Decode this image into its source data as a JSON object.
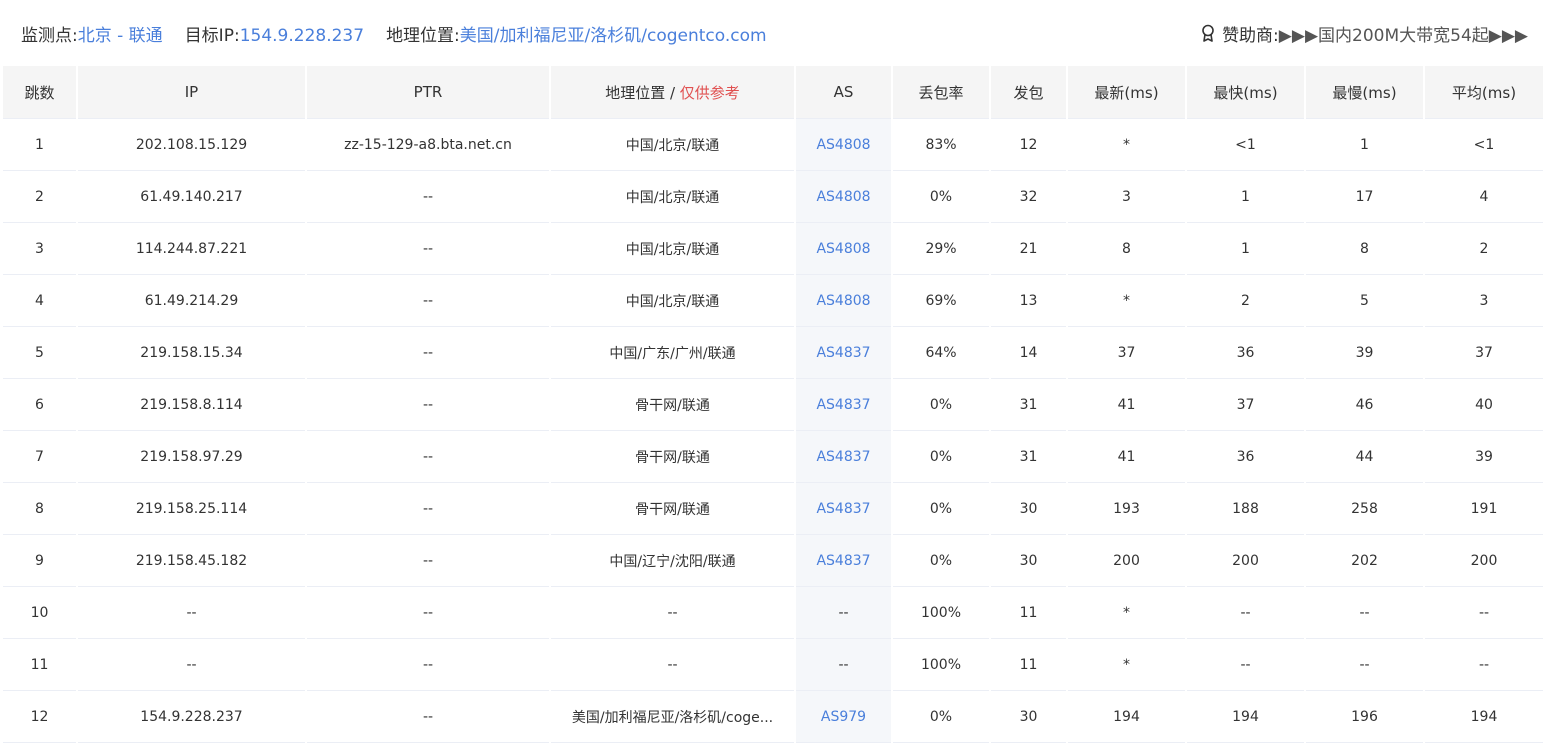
{
  "header": {
    "monitor_label": "监测点:",
    "monitor_value": "北京 - 联通",
    "target_label": "目标IP:",
    "target_value": "154.9.228.237",
    "geo_label": "地理位置:",
    "geo_value": "美国/加利福尼亚/洛杉矶/cogentco.com",
    "sponsor_icon": "award-icon",
    "sponsor_label": "赞助商:",
    "sponsor_text": "▶▶▶国内200M大带宽54起▶▶▶"
  },
  "columns": {
    "hop": "跳数",
    "ip": "IP",
    "ptr": "PTR",
    "geo": "地理位置",
    "geo_sep": " / ",
    "geo_note": "仅供参考",
    "as": "AS",
    "loss": "丢包率",
    "sent": "发包",
    "last": "最新(ms)",
    "best": "最快(ms)",
    "worst": "最慢(ms)",
    "avg": "平均(ms)"
  },
  "rows": [
    {
      "hop": "1",
      "ip": "202.108.15.129",
      "ptr": "zz-15-129-a8.bta.net.cn",
      "geo": "中国/北京/联通",
      "as": "AS4808",
      "loss": "83%",
      "sent": "12",
      "last": "*",
      "best": "<1",
      "worst": "1",
      "avg": "<1"
    },
    {
      "hop": "2",
      "ip": "61.49.140.217",
      "ptr": "--",
      "geo": "中国/北京/联通",
      "as": "AS4808",
      "loss": "0%",
      "sent": "32",
      "last": "3",
      "best": "1",
      "worst": "17",
      "avg": "4"
    },
    {
      "hop": "3",
      "ip": "114.244.87.221",
      "ptr": "--",
      "geo": "中国/北京/联通",
      "as": "AS4808",
      "loss": "29%",
      "sent": "21",
      "last": "8",
      "best": "1",
      "worst": "8",
      "avg": "2"
    },
    {
      "hop": "4",
      "ip": "61.49.214.29",
      "ptr": "--",
      "geo": "中国/北京/联通",
      "as": "AS4808",
      "loss": "69%",
      "sent": "13",
      "last": "*",
      "best": "2",
      "worst": "5",
      "avg": "3"
    },
    {
      "hop": "5",
      "ip": "219.158.15.34",
      "ptr": "--",
      "geo": "中国/广东/广州/联通",
      "as": "AS4837",
      "loss": "64%",
      "sent": "14",
      "last": "37",
      "best": "36",
      "worst": "39",
      "avg": "37"
    },
    {
      "hop": "6",
      "ip": "219.158.8.114",
      "ptr": "--",
      "geo": "骨干网/联通",
      "as": "AS4837",
      "loss": "0%",
      "sent": "31",
      "last": "41",
      "best": "37",
      "worst": "46",
      "avg": "40"
    },
    {
      "hop": "7",
      "ip": "219.158.97.29",
      "ptr": "--",
      "geo": "骨干网/联通",
      "as": "AS4837",
      "loss": "0%",
      "sent": "31",
      "last": "41",
      "best": "36",
      "worst": "44",
      "avg": "39"
    },
    {
      "hop": "8",
      "ip": "219.158.25.114",
      "ptr": "--",
      "geo": "骨干网/联通",
      "as": "AS4837",
      "loss": "0%",
      "sent": "30",
      "last": "193",
      "best": "188",
      "worst": "258",
      "avg": "191"
    },
    {
      "hop": "9",
      "ip": "219.158.45.182",
      "ptr": "--",
      "geo": "中国/辽宁/沈阳/联通",
      "as": "AS4837",
      "loss": "0%",
      "sent": "30",
      "last": "200",
      "best": "200",
      "worst": "202",
      "avg": "200"
    },
    {
      "hop": "10",
      "ip": "--",
      "ptr": "--",
      "geo": "--",
      "as": "--",
      "loss": "100%",
      "sent": "11",
      "last": "*",
      "best": "--",
      "worst": "--",
      "avg": "--"
    },
    {
      "hop": "11",
      "ip": "--",
      "ptr": "--",
      "geo": "--",
      "as": "--",
      "loss": "100%",
      "sent": "11",
      "last": "*",
      "best": "--",
      "worst": "--",
      "avg": "--"
    },
    {
      "hop": "12",
      "ip": "154.9.228.237",
      "ptr": "--",
      "geo": "美国/加利福尼亚/洛杉矶/coge...",
      "as": "AS979",
      "loss": "0%",
      "sent": "30",
      "last": "194",
      "best": "194",
      "worst": "196",
      "avg": "194"
    }
  ]
}
